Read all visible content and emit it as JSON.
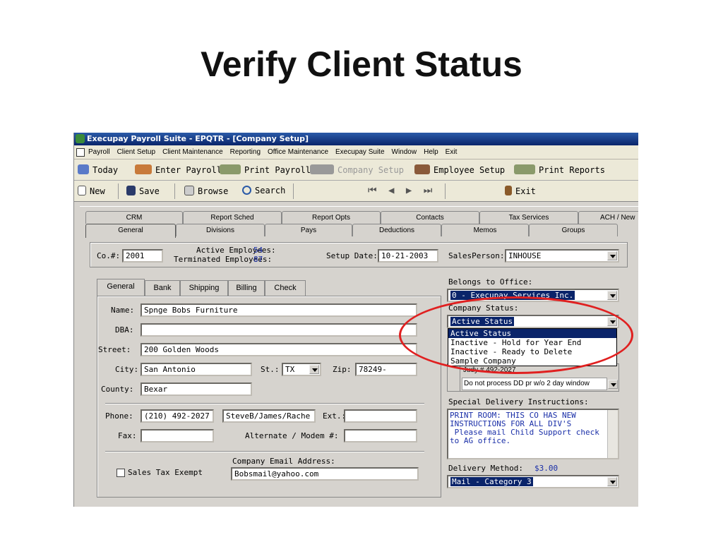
{
  "slide": {
    "title": "Verify Client Status"
  },
  "window": {
    "title": "Execupay Payroll Suite - EPQTR - [Company Setup]"
  },
  "menu": [
    "Payroll",
    "Client Setup",
    "Client Maintenance",
    "Reporting",
    "Office Maintenance",
    "Execupay Suite",
    "Window",
    "Help",
    "Exit"
  ],
  "toolbar1": {
    "today": "Today",
    "enter_payroll": "Enter Payroll",
    "print_payroll": "Print Payroll",
    "company_setup": "Company Setup",
    "employee_setup": "Employee Setup",
    "print_reports": "Print Reports"
  },
  "toolbar2": {
    "new": "New",
    "save": "Save",
    "browse": "Browse",
    "search": "Search",
    "exit": "Exit"
  },
  "tabs_top": [
    "CRM",
    "Report Sched",
    "Report Opts",
    "Contacts",
    "Tax Services",
    "ACH / New H"
  ],
  "tabs_bottom": [
    "General",
    "Divisions",
    "Pays",
    "Deductions",
    "Memos",
    "Groups"
  ],
  "header": {
    "co_label": "Co.#:",
    "co_value": "2001",
    "active_label": "Active Employees:",
    "active_value": "54",
    "terminated_label": "Terminated Employees:",
    "terminated_value": "87",
    "setup_date_label": "Setup Date:",
    "setup_date_value": "10-21-2003",
    "salesperson_label": "SalesPerson:",
    "salesperson_value": "INHOUSE"
  },
  "subtabs": [
    "General",
    "Bank",
    "Shipping",
    "Billing",
    "Check"
  ],
  "form": {
    "name_label": "Name:",
    "name_value": "Spnge Bobs Furniture",
    "dba_label": "DBA:",
    "dba_value": "",
    "street_label": "Street:",
    "street_value": "200 Golden Woods",
    "city_label": "City:",
    "city_value": "San Antonio",
    "st_label": "St.:",
    "st_value": "TX",
    "zip_label": "Zip:",
    "zip_value": "78249-",
    "county_label": "County:",
    "county_value": "Bexar",
    "phone_label": "Phone:",
    "phone_value": "(210) 492-2027",
    "contact_value": "SteveB/James/Rache",
    "ext_label": "Ext.:",
    "ext_value": "",
    "fax_label": "Fax:",
    "fax_value": "",
    "alt_label": "Alternate / Modem #:",
    "alt_value": "",
    "email_label": "Company Email Address:",
    "email_value": "Bobsmail@yahoo.com",
    "tax_exempt_label": "Sales Tax Exempt"
  },
  "right": {
    "office_label": "Belongs to Office:",
    "office_value": "0 - Execupay Services Inc.",
    "status_label": "Company Status:",
    "status_value": "Active Status",
    "status_options": [
      "Active Status",
      "Inactive - Hold for Year End",
      "Inactive - Ready to Delete",
      "Sample Company"
    ],
    "contact_row1": "Judy # 492-2027",
    "contact_row2": "Do not process DD pr w/o 2 day window",
    "delivery_instr_label": "Special Delivery Instructions:",
    "delivery_instr_text": "PRINT ROOM: THIS CO HAS NEW INSTRUCTIONS FOR ALL DIV'S\n Please mail Child Support check to AG office.",
    "delivery_method_label": "Delivery Method:",
    "delivery_method_cost": "$3.00",
    "delivery_method_value": "Mail - Category 3"
  }
}
